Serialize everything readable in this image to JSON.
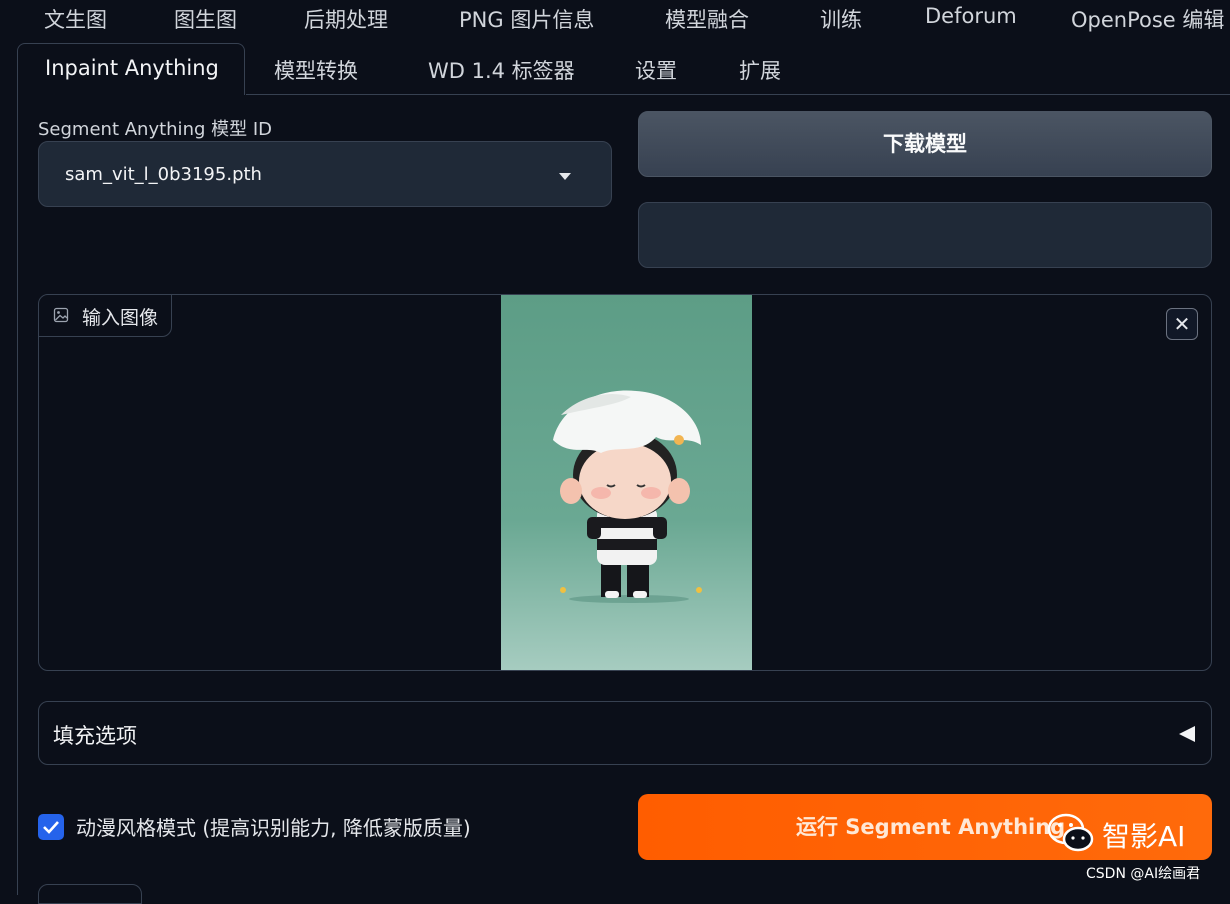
{
  "top_tabs": [
    "文生图",
    "图生图",
    "后期处理",
    "PNG 图片信息",
    "模型融合",
    "训练",
    "Deforum",
    "OpenPose 编辑"
  ],
  "sub_tabs": [
    "Inpaint Anything",
    "模型转换",
    "WD 1.4 标签器",
    "设置",
    "扩展"
  ],
  "active_sub_tab": "Inpaint Anything",
  "segment": {
    "model_label": "Segment Anything 模型 ID",
    "model_value": "sam_vit_l_0b3195.pth",
    "download_button": "下载模型",
    "status_text": ""
  },
  "input_image": {
    "label": "输入图像",
    "close_symbol": "✕"
  },
  "fill_options": {
    "label": "填充选项"
  },
  "anime_mode": {
    "label": "动漫风格模式 (提高识别能力, 降低蒙版质量)",
    "checked": true
  },
  "run_button": "运行 Segment Anything",
  "watermark": {
    "brand": "智影AI",
    "credit": "CSDN @AI绘画君"
  },
  "colors": {
    "background": "#0b0f19",
    "accent_orange": "#ff6000",
    "checkbox_blue": "#2563eb"
  }
}
